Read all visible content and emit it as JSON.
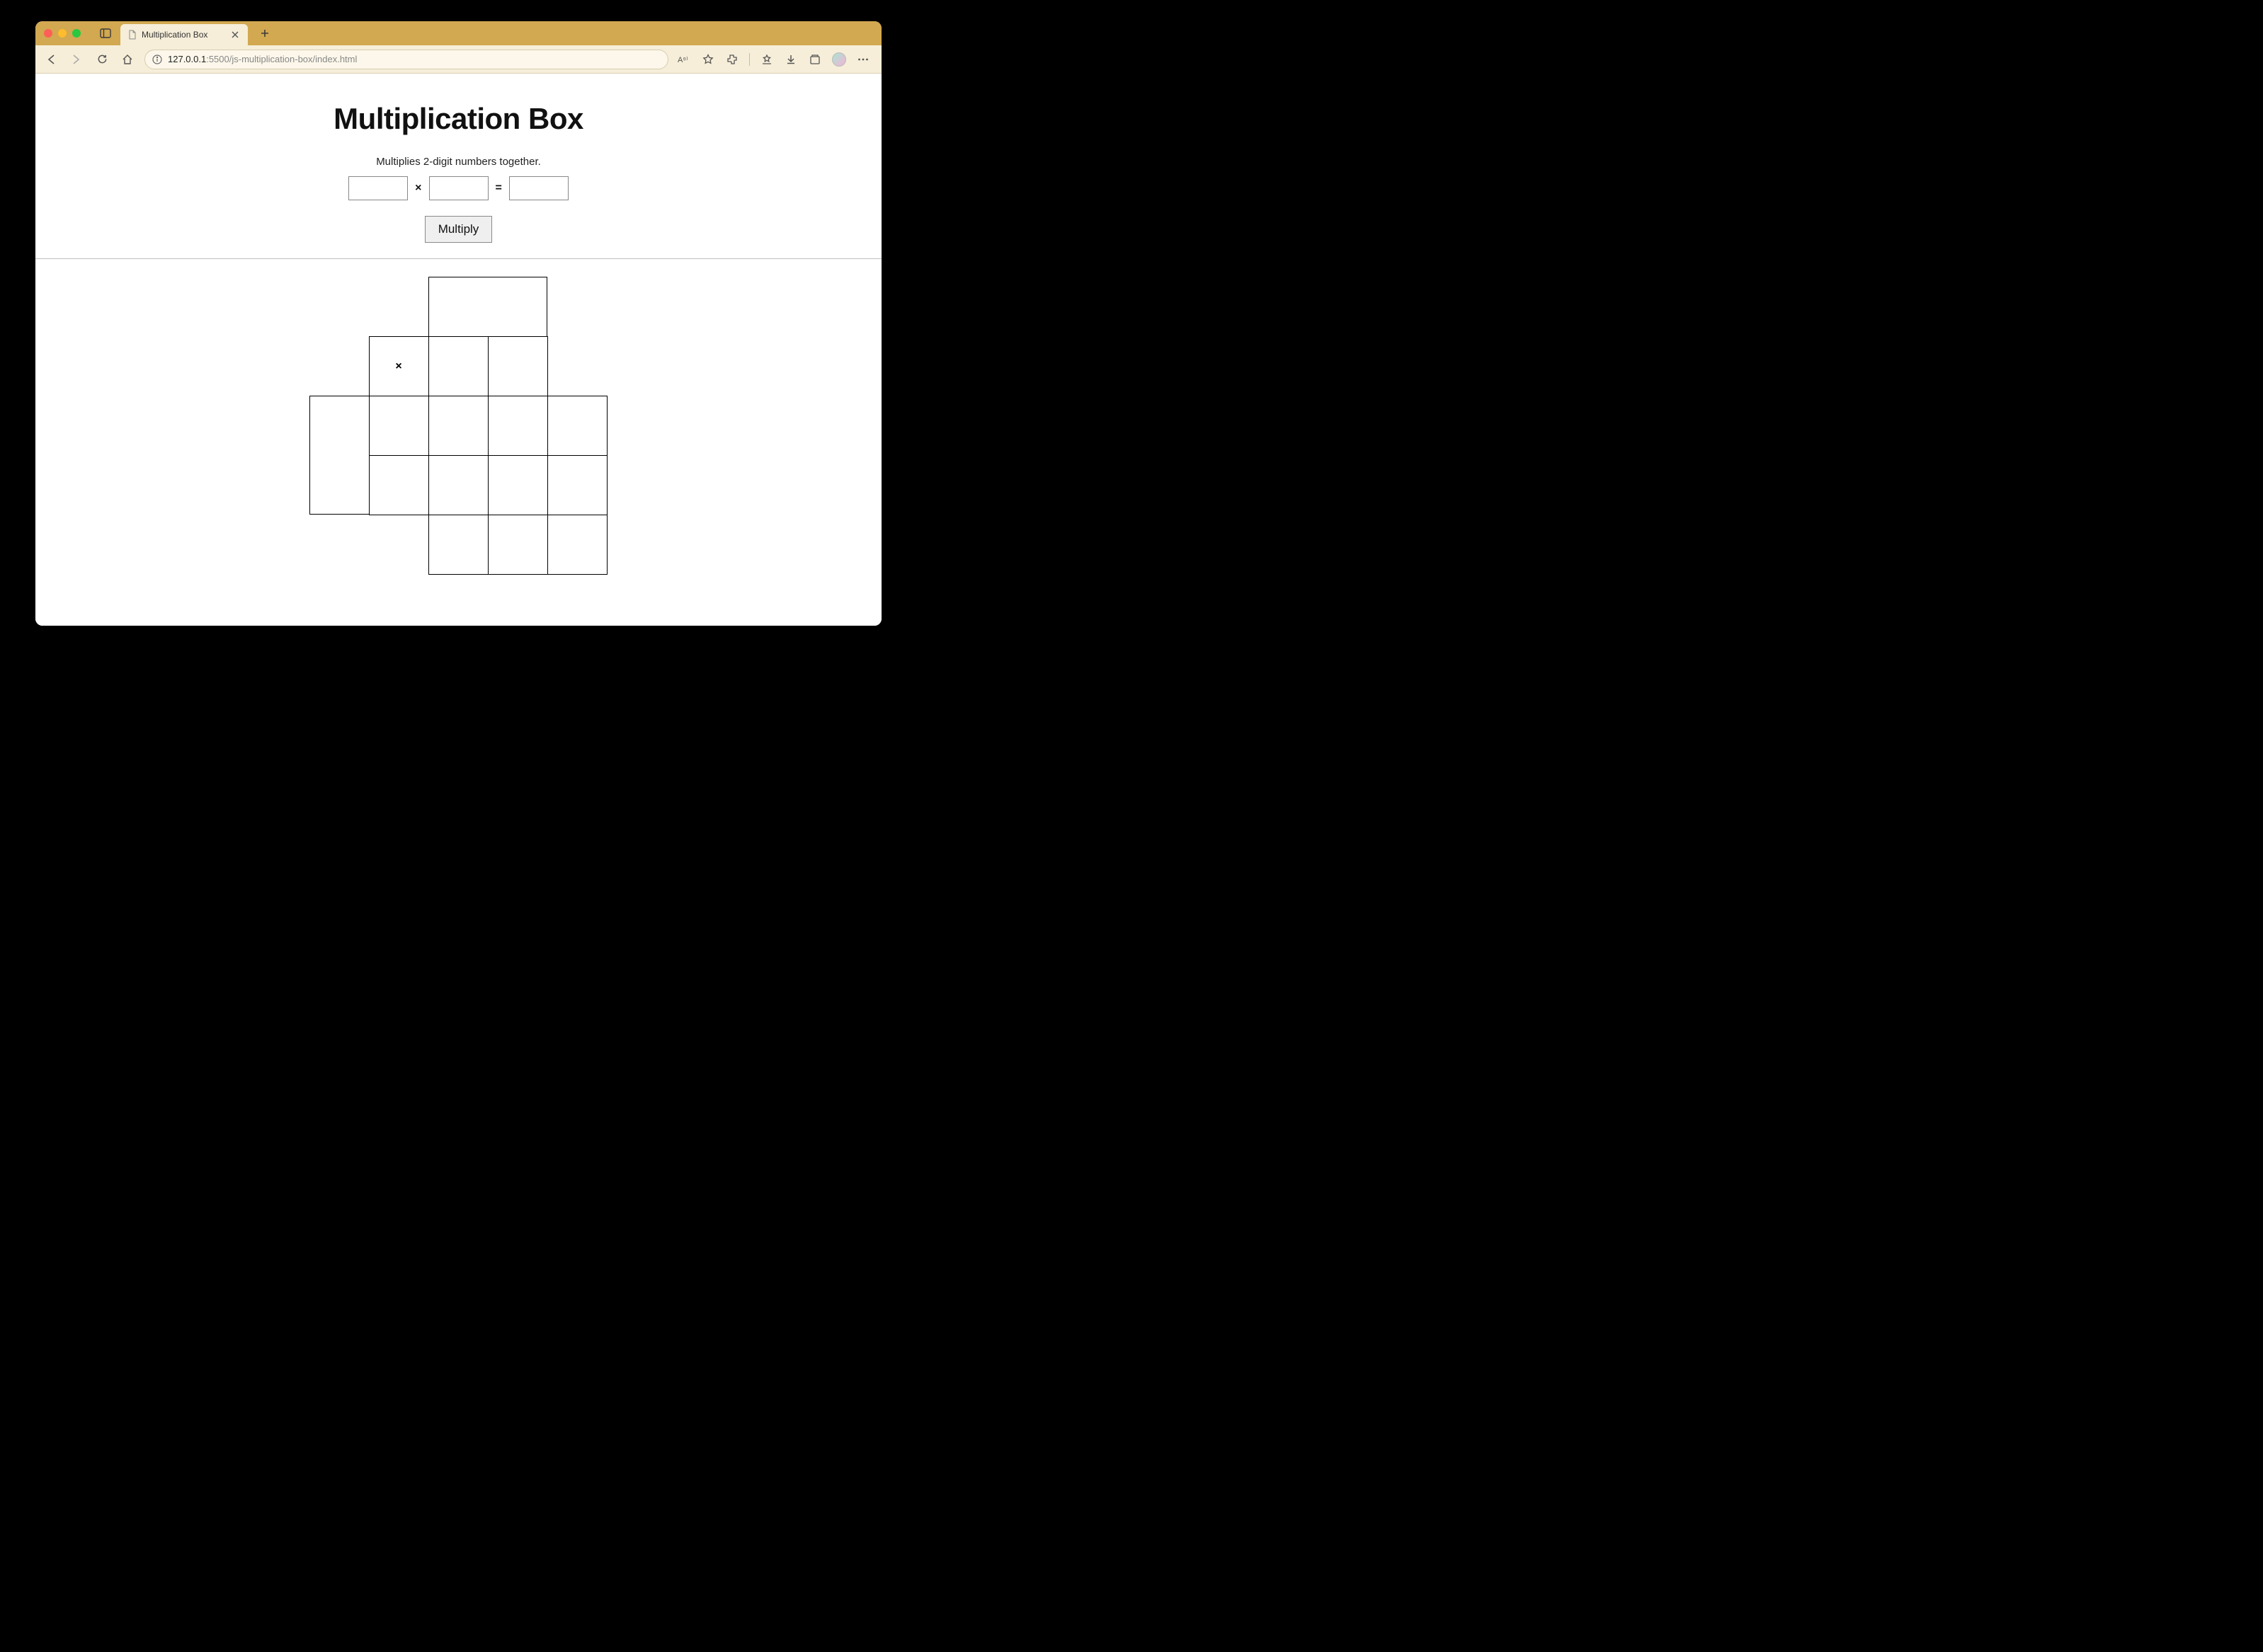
{
  "browser": {
    "tab_title": "Multiplication Box",
    "url": {
      "host": "127.0.0.1",
      "port": ":5500",
      "path": "/js-multiplication-box/index.html"
    }
  },
  "page": {
    "title": "Multiplication Box",
    "subtitle": "Multiplies 2-digit numbers together.",
    "symbols": {
      "times": "×",
      "equals": "="
    },
    "inputs": {
      "a": "",
      "b": "",
      "result": ""
    },
    "button_label": "Multiply",
    "grid_times_symbol": "×"
  }
}
